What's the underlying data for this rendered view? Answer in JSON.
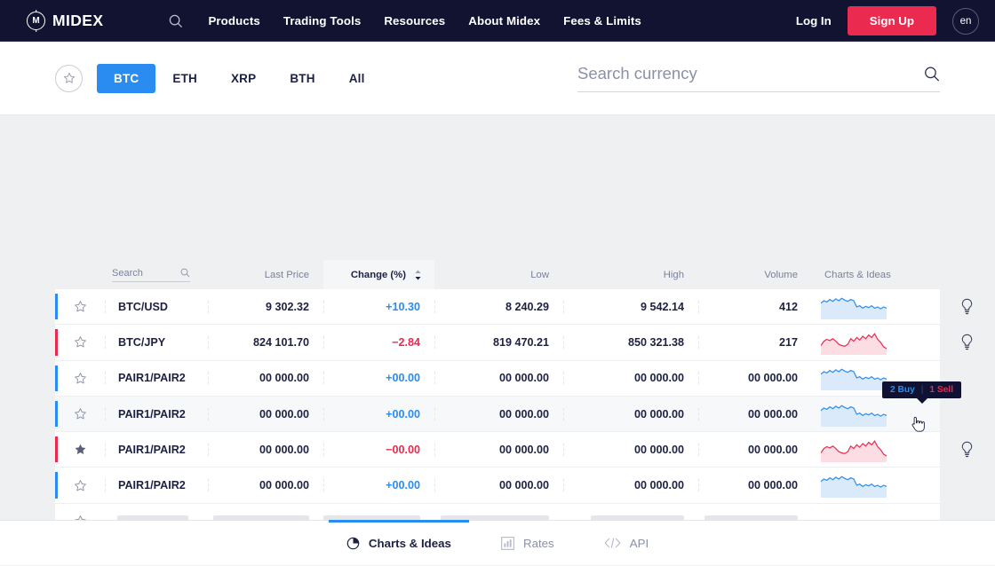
{
  "header": {
    "logo_text": "MIDEX",
    "search_icon": "search-icon",
    "nav_links": [
      "Products",
      "Trading Tools",
      "Resources",
      "About Midex",
      "Fees & Limits"
    ],
    "login_label": "Log In",
    "signup_label": "Sign Up",
    "lang_label": "en",
    "bg_color": "#121331",
    "signup_color": "#ea2a4f"
  },
  "filters": {
    "favorites_icon": "star-outline-icon",
    "tabs": [
      "BTC",
      "ETH",
      "XRP",
      "BTH",
      "All"
    ],
    "active_tab": "BTC",
    "active_color": "#2a8cf0"
  },
  "search": {
    "placeholder": "Search currency",
    "value": "",
    "icon": "search-icon"
  },
  "table": {
    "search_label": "Search",
    "search_icon": "search-icon",
    "columns": {
      "last_price": "Last Price",
      "change": "Change (%)",
      "low": "Low",
      "high": "High",
      "volume": "Volume",
      "charts": "Charts & Ideas"
    },
    "sorted_column": "Change (%)",
    "sort_icon": "sort-arrows-icon",
    "rows": [
      {
        "pair": "BTC/USD",
        "last_price": "9 302.32",
        "change": "+10.30",
        "low": "8 240.29",
        "high": "9 542.14",
        "volume": "412",
        "direction": "up",
        "favorite": false,
        "bulb": true,
        "hover": false
      },
      {
        "pair": "BTC/JPY",
        "last_price": "824 101.70",
        "change": "−2.84",
        "low": "819 470.21",
        "high": "850 321.38",
        "volume": "217",
        "direction": "down",
        "favorite": false,
        "bulb": true,
        "hover": false
      },
      {
        "pair": "PAIR1/PAIR2",
        "last_price": "00 000.00",
        "change": "+00.00",
        "low": "00 000.00",
        "high": "00 000.00",
        "volume": "00 000.00",
        "direction": "up",
        "favorite": false,
        "bulb": false,
        "hover": false
      },
      {
        "pair": "PAIR1/PAIR2",
        "last_price": "00 000.00",
        "change": "+00.00",
        "low": "00 000.00",
        "high": "00 000.00",
        "volume": "00 000.00",
        "direction": "up",
        "favorite": false,
        "bulb": false,
        "hover": true
      },
      {
        "pair": "PAIR1/PAIR2",
        "last_price": "00 000.00",
        "change": "−00.00",
        "low": "00 000.00",
        "high": "00 000.00",
        "volume": "00 000.00",
        "direction": "down",
        "favorite": true,
        "bulb": true,
        "hover": false
      },
      {
        "pair": "PAIR1/PAIR2",
        "last_price": "00 000.00",
        "change": "+00.00",
        "low": "00 000.00",
        "high": "00 000.00",
        "volume": "00 000.00",
        "direction": "up",
        "favorite": false,
        "bulb": false,
        "hover": false
      }
    ],
    "placeholder_row": {
      "favorite": false,
      "bars": 6
    },
    "up_color": "#2a8cf0",
    "down_color": "#ea2a4f"
  },
  "tooltip": {
    "buy": "2 Buy",
    "divider": "|",
    "sell": "1 Sell",
    "bg_color": "#101233"
  },
  "bottom_tabs": [
    {
      "label": "Charts & Ideas",
      "icon": "pie-chart-icon",
      "active": true
    },
    {
      "label": "Rates",
      "icon": "bar-chart-icon",
      "active": false
    },
    {
      "label": "API",
      "icon": "code-icon",
      "active": false
    }
  ],
  "chart_data": {
    "type": "line",
    "title": "Row sparklines (7-day price trend)",
    "series": [
      {
        "name": "BTC/USD",
        "direction": "up",
        "values": [
          52,
          60,
          56,
          64,
          58,
          66,
          60,
          68,
          62,
          58,
          64,
          60,
          40,
          44,
          36,
          42,
          38,
          44,
          36,
          40,
          34,
          40,
          36
        ]
      },
      {
        "name": "BTC/JPY",
        "direction": "down",
        "values": [
          30,
          44,
          50,
          46,
          52,
          44,
          34,
          30,
          28,
          34,
          52,
          44,
          56,
          48,
          60,
          52,
          64,
          56,
          68,
          50,
          40,
          26,
          20
        ]
      },
      {
        "name": "PAIR1/PAIR2",
        "direction": "up",
        "values": [
          52,
          60,
          56,
          64,
          58,
          66,
          60,
          68,
          62,
          58,
          64,
          60,
          40,
          44,
          36,
          42,
          38,
          44,
          36,
          40,
          34,
          40,
          36
        ]
      },
      {
        "name": "PAIR1/PAIR2",
        "direction": "up",
        "values": [
          52,
          60,
          56,
          64,
          58,
          66,
          60,
          68,
          62,
          58,
          64,
          60,
          40,
          44,
          36,
          42,
          38,
          44,
          36,
          40,
          34,
          40,
          36
        ]
      },
      {
        "name": "PAIR1/PAIR2",
        "direction": "down",
        "values": [
          30,
          44,
          50,
          46,
          52,
          44,
          34,
          30,
          28,
          34,
          52,
          44,
          56,
          48,
          60,
          52,
          64,
          56,
          68,
          50,
          40,
          26,
          20
        ]
      },
      {
        "name": "PAIR1/PAIR2",
        "direction": "up",
        "values": [
          52,
          60,
          56,
          64,
          58,
          66,
          60,
          68,
          62,
          58,
          64,
          60,
          40,
          44,
          36,
          42,
          38,
          44,
          36,
          40,
          34,
          40,
          36
        ]
      }
    ],
    "ylim": [
      0,
      80
    ],
    "grid": false,
    "legend": "none"
  }
}
